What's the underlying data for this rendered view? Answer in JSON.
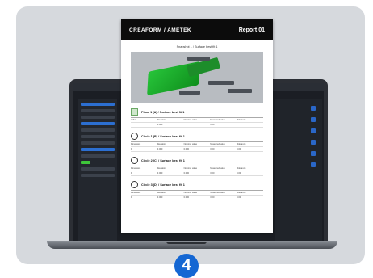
{
  "report": {
    "brand": "CREAFORM / AMETEK",
    "title": "Report 01",
    "view_caption": "Snapshot 1 / Surface best fit 1"
  },
  "sections": [
    {
      "title": "Plane 1 (A) / Surface best fit 1",
      "icon": "plane-icon",
      "columns": [
        "Label",
        "Deviation",
        "Nominal value",
        "Measured value",
        "Tolerance"
      ],
      "values": [
        "",
        "0.000",
        "",
        "0.00",
        ""
      ]
    },
    {
      "title": "Circle 1 (B) / Surface best fit 1",
      "icon": "circle-icon",
      "columns": [
        "Dimension",
        "Deviation",
        "Nominal value",
        "Measured value",
        "Tolerance"
      ],
      "values": [
        "D",
        "0.000",
        "0.000",
        "0.00",
        "0.00"
      ]
    },
    {
      "title": "Circle 2 (C) / Surface best fit 1",
      "icon": "circle-icon",
      "columns": [
        "Dimension",
        "Deviation",
        "Nominal value",
        "Measured value",
        "Tolerance"
      ],
      "values": [
        "D",
        "0.000",
        "0.000",
        "0.00",
        "0.00"
      ]
    },
    {
      "title": "Circle 3 (D) / Surface best fit 1",
      "icon": "circle-icon",
      "columns": [
        "Dimension",
        "Deviation",
        "Nominal value",
        "Measured value",
        "Tolerance"
      ],
      "values": [
        "D",
        "0.000",
        "0.000",
        "0.00",
        "0.00"
      ]
    }
  ],
  "step_badge": "4",
  "colors": {
    "accent": "#1567d3",
    "part": "#27c43a",
    "header": "#0c0c0c"
  }
}
